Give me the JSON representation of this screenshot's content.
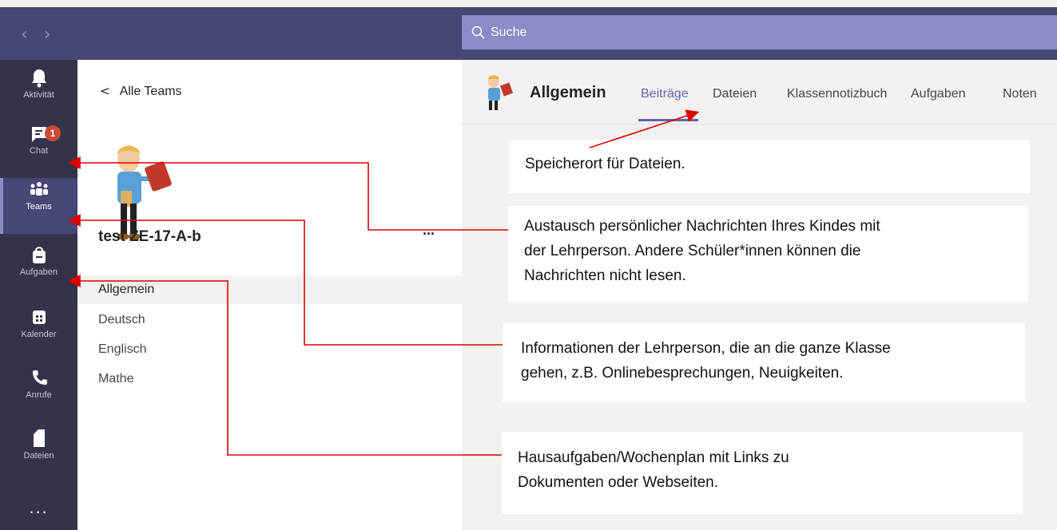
{
  "topbar": {
    "back_arrow": "‹",
    "forward_arrow": "›",
    "search_placeholder": "Suche"
  },
  "rail": {
    "items": [
      {
        "label": "Aktivität",
        "icon": "bell-icon"
      },
      {
        "label": "Chat",
        "icon": "chat-icon",
        "badge": "1"
      },
      {
        "label": "Teams",
        "icon": "teams-icon"
      },
      {
        "label": "Aufgaben",
        "icon": "assignments-icon"
      },
      {
        "label": "Kalender",
        "icon": "calendar-icon"
      },
      {
        "label": "Anrufe",
        "icon": "phone-icon"
      },
      {
        "label": "Dateien",
        "icon": "file-icon"
      }
    ],
    "more": "..."
  },
  "teams_panel": {
    "back_label": "Alle Teams",
    "team_name": "test ZE-17-A-b",
    "more": "...",
    "channels": [
      "Allgemein",
      "Deutsch",
      "Englisch",
      "Mathe"
    ]
  },
  "channel_header": {
    "title": "Allgemein",
    "tabs": [
      "Beiträge",
      "Dateien",
      "Klassennotizbuch",
      "Aufgaben",
      "Noten"
    ]
  },
  "annotations": {
    "files_note": "Speicherort für Dateien.",
    "chat_note": [
      "Austausch persönlicher Nachrichten Ihres Kindes mit",
      "der Lehrperson. Andere Schüler*innen können die",
      "Nachrichten nicht lesen."
    ],
    "teams_note": [
      "Informationen der Lehrperson, die an die ganze Klasse",
      "gehen, z.B. Onlinebesprechungen, Neuigkeiten."
    ],
    "tasks_note": [
      "Hausaufgaben/Wochenplan mit Links zu",
      "Dokumenten oder Webseiten."
    ]
  },
  "colors": {
    "topbar": "#464775",
    "rail": "#33344a",
    "accent": "#6264a7",
    "badge": "#cc4a31",
    "annotation_line": "#e00000"
  }
}
